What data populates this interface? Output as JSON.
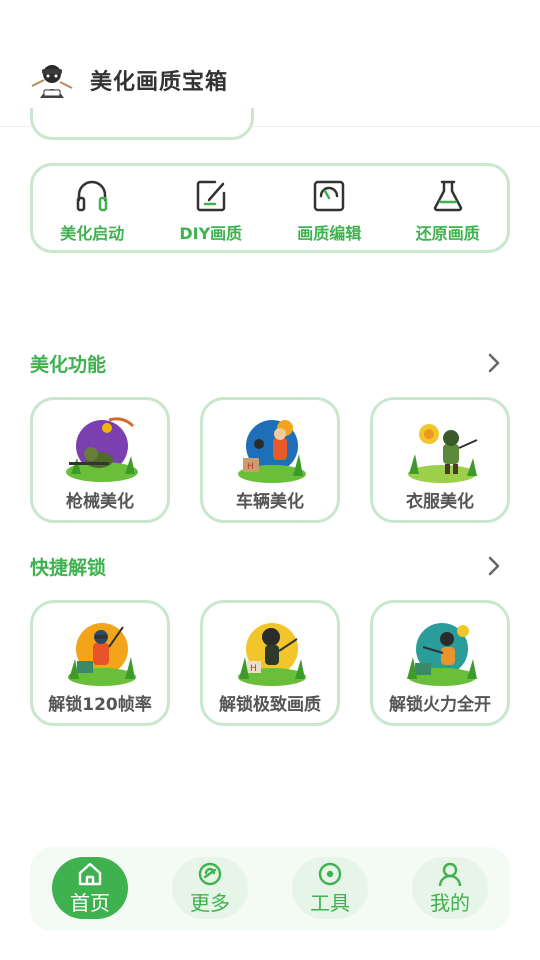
{
  "header": {
    "title": "美化画质宝箱"
  },
  "quick_bar": {
    "items": [
      {
        "label": "美化启动",
        "icon": "headphones-icon"
      },
      {
        "label": "DIY画质",
        "icon": "edit-square-icon"
      },
      {
        "label": "画质编辑",
        "icon": "gauge-icon"
      },
      {
        "label": "还原画质",
        "icon": "flask-icon"
      }
    ]
  },
  "sections": {
    "beautify": {
      "title": "美化功能",
      "cards": [
        {
          "label": "枪械美化"
        },
        {
          "label": "车辆美化"
        },
        {
          "label": "衣服美化"
        }
      ]
    },
    "unlock": {
      "title": "快捷解锁",
      "cards": [
        {
          "label": "解锁120帧率"
        },
        {
          "label": "解锁极致画质"
        },
        {
          "label": "解锁火力全开"
        }
      ]
    }
  },
  "tabbar": {
    "tabs": [
      {
        "label": "首页",
        "icon": "home-icon",
        "active": true
      },
      {
        "label": "更多",
        "icon": "compass-icon",
        "active": false
      },
      {
        "label": "工具",
        "icon": "circle-dot-icon",
        "active": false
      },
      {
        "label": "我的",
        "icon": "user-icon",
        "active": false
      }
    ]
  },
  "colors": {
    "accent": "#3fb24f",
    "border": "#c9e7cf",
    "tab_bg": "#f4fbf5"
  }
}
